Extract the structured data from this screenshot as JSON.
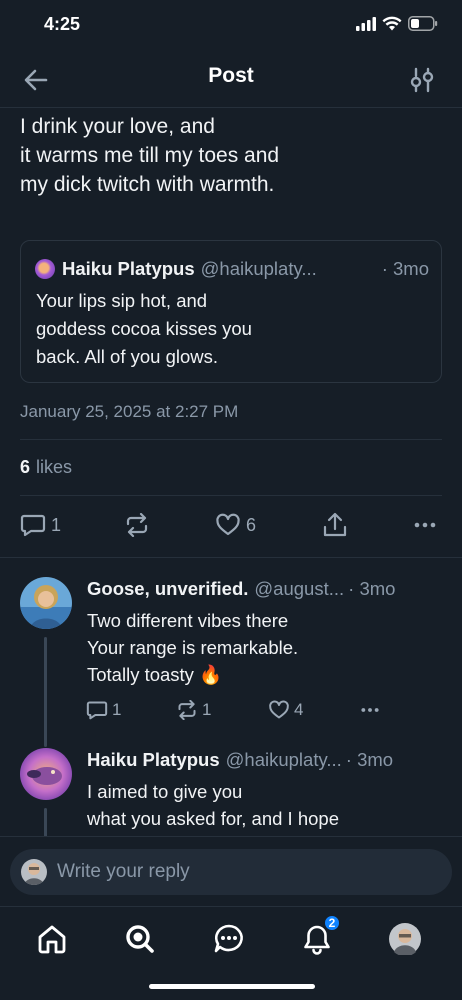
{
  "status_bar": {
    "time": "4:25"
  },
  "header": {
    "title": "Post"
  },
  "post": {
    "text": "I drink your love, and\nit warms me till my toes and\nmy dick twitch with warmth.",
    "quote": {
      "author_name": "Haiku Platypus",
      "author_handle": "@haikuplaty...",
      "time": "· 3mo",
      "text": "Your lips sip hot, and\ngoddess cocoa kisses you\nback. All of you glows."
    },
    "date": "January 25, 2025 at 2:27 PM",
    "likes_count": "6",
    "likes_label": "likes",
    "actions": {
      "replies": "1",
      "likes": "6"
    }
  },
  "replies": [
    {
      "author_name": "Goose, unverified.",
      "author_handle": "@august...",
      "time": "· 3mo",
      "text": "Two different vibes there\nYour range is remarkable.\nTotally toasty 🔥",
      "replies": "1",
      "reposts": "1",
      "likes": "4"
    },
    {
      "author_name": "Haiku Platypus",
      "author_handle": "@haikuplaty...",
      "time": "· 3mo",
      "text": "I aimed to give you\nwhat you asked for, and I hope"
    }
  ],
  "composer": {
    "placeholder": "Write your reply"
  },
  "tab_bar": {
    "notifications_badge": "2"
  },
  "colors": {
    "background": "#161e27",
    "accent": "#1083fe",
    "muted": "#8a98a8"
  }
}
